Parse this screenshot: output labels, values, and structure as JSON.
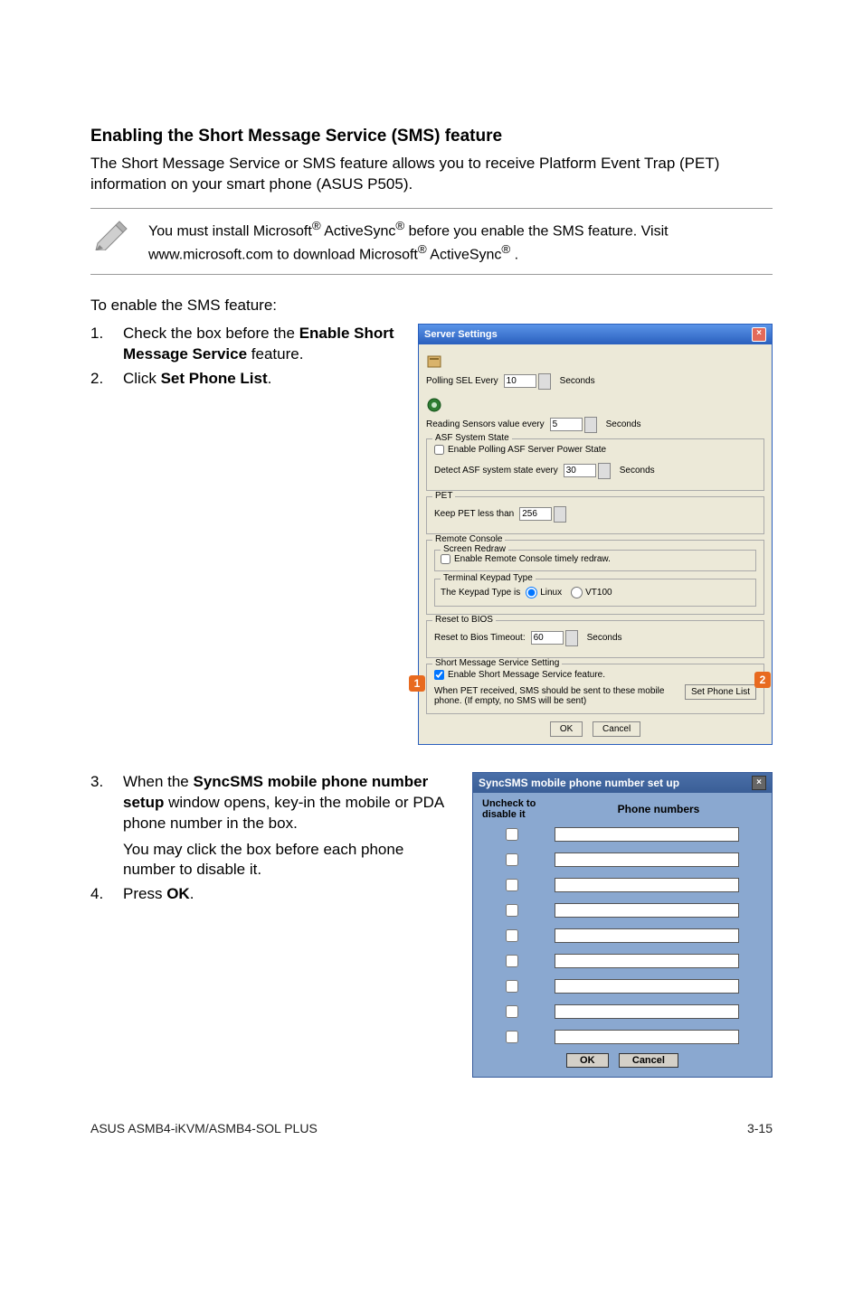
{
  "section_title": "Enabling the Short Message Service (SMS) feature",
  "intro": "The Short Message Service or SMS feature allows you to receive Platform Event Trap (PET) information on your smart phone (ASUS P505).",
  "note": {
    "prefix": "You must install Microsoft",
    "sup1": "®",
    "mid1": " ActiveSync",
    "sup2": "®",
    "mid2": " before you enable the SMS feature. Visit www.microsoft.com to download Microsoft",
    "sup3": "®",
    "mid3": " ActiveSync",
    "sup4": "®",
    "tail": " ."
  },
  "lead": "To enable the SMS feature:",
  "steps1": [
    {
      "n": "1.",
      "pre": "Check the box before the ",
      "b": "Enable Short Message Service",
      "post": " feature."
    },
    {
      "n": "2.",
      "pre": "Click ",
      "b": "Set Phone List",
      "post": "."
    }
  ],
  "steps2": [
    {
      "n": "3.",
      "pre": "When the ",
      "b": "SyncSMS mobile phone number setup",
      "post": " window opens, key-in the mobile or PDA phone number in the box.",
      "extra": "You may click the box before each phone number to disable it."
    },
    {
      "n": "4.",
      "pre": " Press ",
      "b": "OK",
      "post": "."
    }
  ],
  "server_settings": {
    "title": "Server Settings",
    "polling_label": "Polling SEL Every",
    "polling_val": "10",
    "seconds": "Seconds",
    "reading_label": "Reading Sensors value every",
    "reading_val": "5",
    "asf_legend": "ASF System State",
    "asf_cb": "Enable Polling ASF Server Power State",
    "asf_detect": "Detect ASF system state every",
    "asf_detect_val": "30",
    "pet_legend": "PET",
    "pet_label": "Keep PET less than",
    "pet_val": "256",
    "remote_legend": "Remote Console",
    "screen_legend": "Screen Redraw",
    "screen_cb": "Enable Remote Console timely redraw.",
    "keypad_legend": "Terminal Keypad Type",
    "keypad_label": "The Keypad Type is",
    "keypad_linux": "Linux",
    "keypad_vt100": "VT100",
    "reset_legend": "Reset to BIOS",
    "reset_label": "Reset to Bios Timeout:",
    "reset_val": "60",
    "sms_legend": "Short Message Service Setting",
    "sms_cb": "Enable Short Message Service feature.",
    "sms_desc": "When PET received, SMS should be sent to these mobile phone. (If empty, no SMS will be sent)",
    "set_phone_btn": "Set Phone List",
    "ok": "OK",
    "cancel": "Cancel",
    "marker1": "1",
    "marker2": "2"
  },
  "syncsms": {
    "title": "SyncSMS mobile phone number set up",
    "col1a": "Uncheck to",
    "col1b": "disable it",
    "col2": "Phone numbers",
    "rows": 9,
    "ok": "OK",
    "cancel": "Cancel"
  },
  "footer_left": "ASUS ASMB4-iKVM/ASMB4-SOL PLUS",
  "footer_right": "3-15"
}
